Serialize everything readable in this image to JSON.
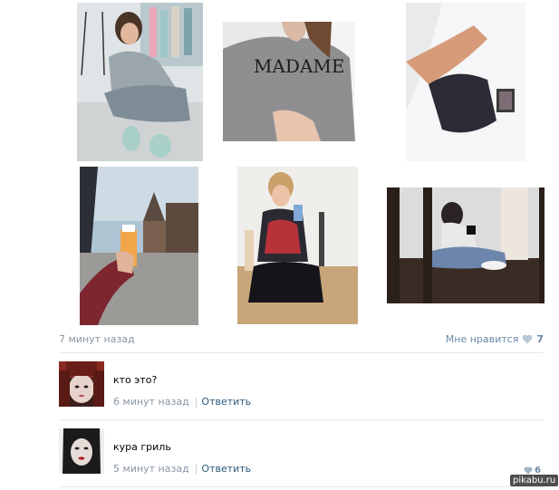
{
  "post": {
    "time": "7 минут назад",
    "like_label": "Мне нравится",
    "like_count": "7"
  },
  "photos": [
    {
      "name": "photo-girl-sitting-boutique"
    },
    {
      "name": "photo-madame-sweater"
    },
    {
      "name": "photo-legs-on-bed"
    },
    {
      "name": "photo-city-drink"
    },
    {
      "name": "photo-mirror-selfie-skirt"
    },
    {
      "name": "photo-sitting-floor-selfie"
    }
  ],
  "sweater_text": "MADAME",
  "comments": [
    {
      "text": "кто это?",
      "time": "6 минут назад",
      "separator": "|",
      "reply": "Ответить"
    },
    {
      "text": "кура гриль",
      "time": "5 минут назад",
      "separator": "|",
      "reply": "Ответить"
    }
  ],
  "watermark": {
    "like_count": "6",
    "site": "pikabu.ru"
  },
  "colors": {
    "link": "#2b587a",
    "meta": "#8a96a3",
    "like": "#6b88a6",
    "divider": "#e5e9ee"
  }
}
